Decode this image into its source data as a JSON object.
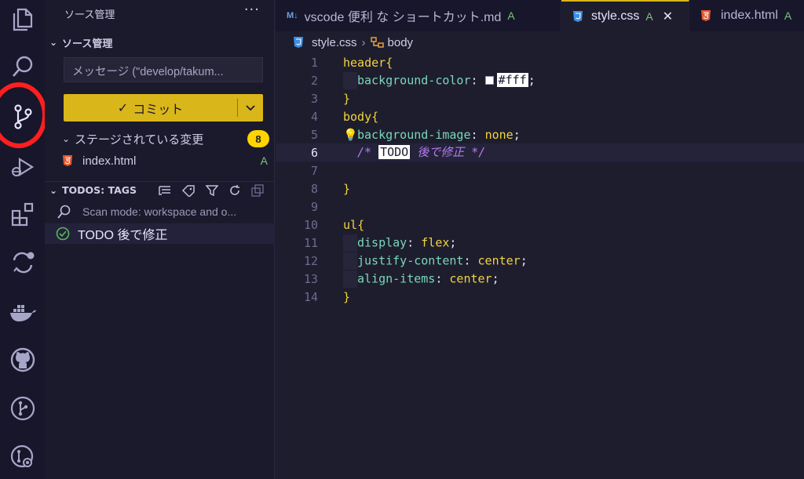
{
  "sidebar": {
    "title": "ソース管理",
    "more": "···",
    "section_title": "ソース管理",
    "message_placeholder": "メッセージ (\"develop/takum...",
    "commit_label": "コミット",
    "staged_label": "ステージされている変更",
    "staged_count": "8",
    "staged_files": [
      {
        "name": "index.html",
        "status": "A"
      }
    ],
    "todos_title": "TODOS: TAGS",
    "scan_mode": "Scan mode: workspace and o...",
    "todo_item": "TODO 後で修正"
  },
  "tabs": [
    {
      "label": "vscode 便利 な ショートカット.md",
      "status": "A",
      "icon": "markdown-icon",
      "active": false
    },
    {
      "label": "style.css",
      "status": "A",
      "icon": "css-icon",
      "active": true,
      "close": "✕"
    },
    {
      "label": "index.html",
      "status": "A",
      "icon": "html-icon",
      "active": false
    }
  ],
  "breadcrumb": {
    "file": "style.css",
    "symbol": "body"
  },
  "editor": {
    "line_numbers": [
      "1",
      "2",
      "3",
      "4",
      "5",
      "6",
      "7",
      "8",
      "9",
      "10",
      "11",
      "12",
      "13",
      "14"
    ],
    "current_line": "6",
    "lines": {
      "l1_sel": "header",
      "l1_brace": "{",
      "l2_prop": "background-color",
      "l2_colon": ":",
      "l2_val": "#fff",
      "l2_semi": ";",
      "l3": "}",
      "l4_sel": "body",
      "l4_brace": "{",
      "l5_prop": "background-image",
      "l5_colon": ":",
      "l5_val": "none",
      "l5_semi": ";",
      "l6_open": "/* ",
      "l6_todo": "TODO",
      "l6_rest": " 後で修正 */",
      "l8": "}",
      "l10_sel": "ul",
      "l10_brace": "{",
      "l11_prop": "display",
      "l11_colon": ":",
      "l11_val": "flex",
      "l11_semi": ";",
      "l12_prop": "justify-content",
      "l12_colon": ":",
      "l12_val": "center",
      "l12_semi": ";",
      "l13_prop": "align-items",
      "l13_colon": ":",
      "l13_val": "center",
      "l13_semi": ";",
      "l14": "}"
    }
  },
  "colors": {
    "accent": "#d9b61a",
    "badge": "#ffd400",
    "highlight_ring": "#ff1f1f",
    "added_status": "#7cc47c"
  },
  "activity_icons": [
    "explorer-icon",
    "search-icon",
    "source-control-icon",
    "run-debug-icon",
    "extensions-icon",
    "git-diff-icon",
    "docker-icon",
    "github-icon",
    "git-graph-icon",
    "gitlens-icon"
  ]
}
